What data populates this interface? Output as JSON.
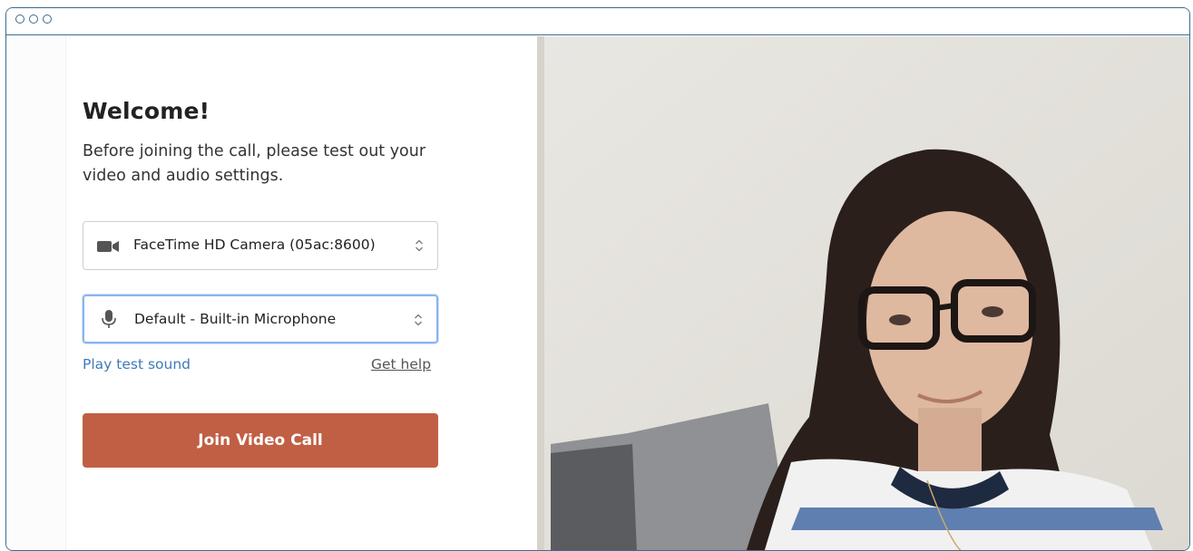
{
  "window": {
    "controls": [
      "window-dot-1",
      "window-dot-2",
      "window-dot-3"
    ]
  },
  "setup": {
    "title": "Welcome!",
    "description": "Before joining the call, please test out your video and audio settings.",
    "camera_select": {
      "icon": "video-camera-icon",
      "value": "FaceTime HD Camera (05ac:8600)"
    },
    "mic_select": {
      "icon": "microphone-icon",
      "value": "Default - Built-in Microphone"
    },
    "play_test_sound": "Play test sound",
    "get_help": "Get help",
    "join_button": "Join Video Call"
  },
  "colors": {
    "accent_button": "#c15f45",
    "link_blue": "#3f7ab8",
    "focus_ring": "#8ab4f0",
    "window_border": "#3e6a8c"
  }
}
